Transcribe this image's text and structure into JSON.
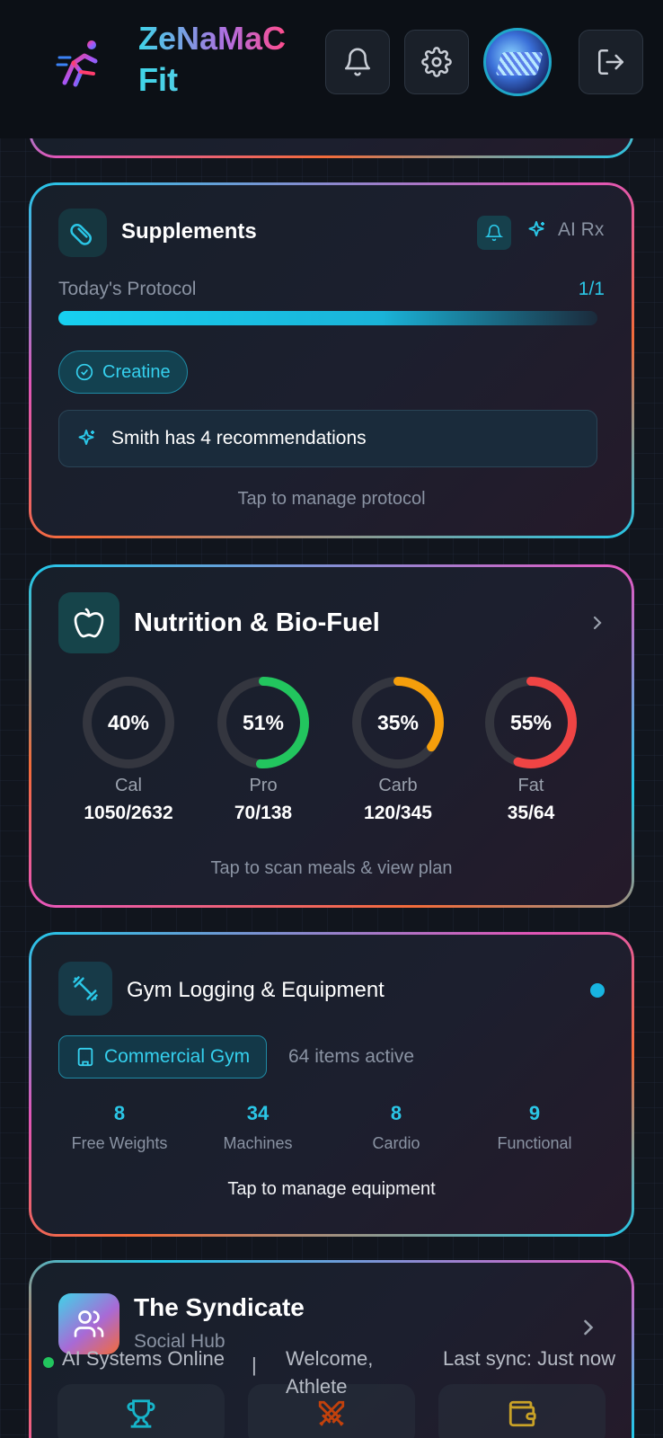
{
  "header": {
    "brand_line1": "ZeNaMaC",
    "brand_line2": "Fit",
    "icons": [
      "bell-icon",
      "gear-icon",
      "logout-icon"
    ]
  },
  "supplements": {
    "title": "Supplements",
    "ai_rx_label": "AI Rx",
    "protocol_label": "Today's Protocol",
    "protocol_count": "1/1",
    "progress": 1.0,
    "chip": "Creatine",
    "recommendation": "Smith has 4 recommendations",
    "footer": "Tap to manage protocol"
  },
  "nutrition": {
    "title": "Nutrition & Bio-Fuel",
    "footer": "Tap to scan meals & view plan",
    "macros": [
      {
        "pct_label": "40%",
        "pct": 40,
        "label": "Cal",
        "value": "1050/2632",
        "color": "#3a3d45"
      },
      {
        "pct_label": "51%",
        "pct": 51,
        "label": "Pro",
        "value": "70/138",
        "color": "#22c55e"
      },
      {
        "pct_label": "35%",
        "pct": 35,
        "label": "Carb",
        "value": "120/345",
        "color": "#f59e0b"
      },
      {
        "pct_label": "55%",
        "pct": 55,
        "label": "Fat",
        "value": "35/64",
        "color": "#ef4444"
      }
    ]
  },
  "gym": {
    "title": "Gym Logging & Equipment",
    "gym_chip": "Commercial Gym",
    "items_active": "64 items active",
    "stats": [
      {
        "num": "8",
        "label": "Free Weights"
      },
      {
        "num": "34",
        "label": "Machines"
      },
      {
        "num": "8",
        "label": "Cardio"
      },
      {
        "num": "9",
        "label": "Functional"
      }
    ],
    "footer": "Tap to manage equipment"
  },
  "syndicate": {
    "title": "The Syndicate",
    "subtitle": "Social Hub"
  },
  "status_bar": {
    "ai_status": "AI Systems Online",
    "welcome": "Welcome, Athlete",
    "sync": "Last sync: Just now",
    "separator": "|"
  },
  "colors": {
    "accent": "#2bc6e6",
    "background": "#11151d",
    "protein": "#22c55e",
    "carb": "#f59e0b",
    "fat": "#ef4444"
  }
}
